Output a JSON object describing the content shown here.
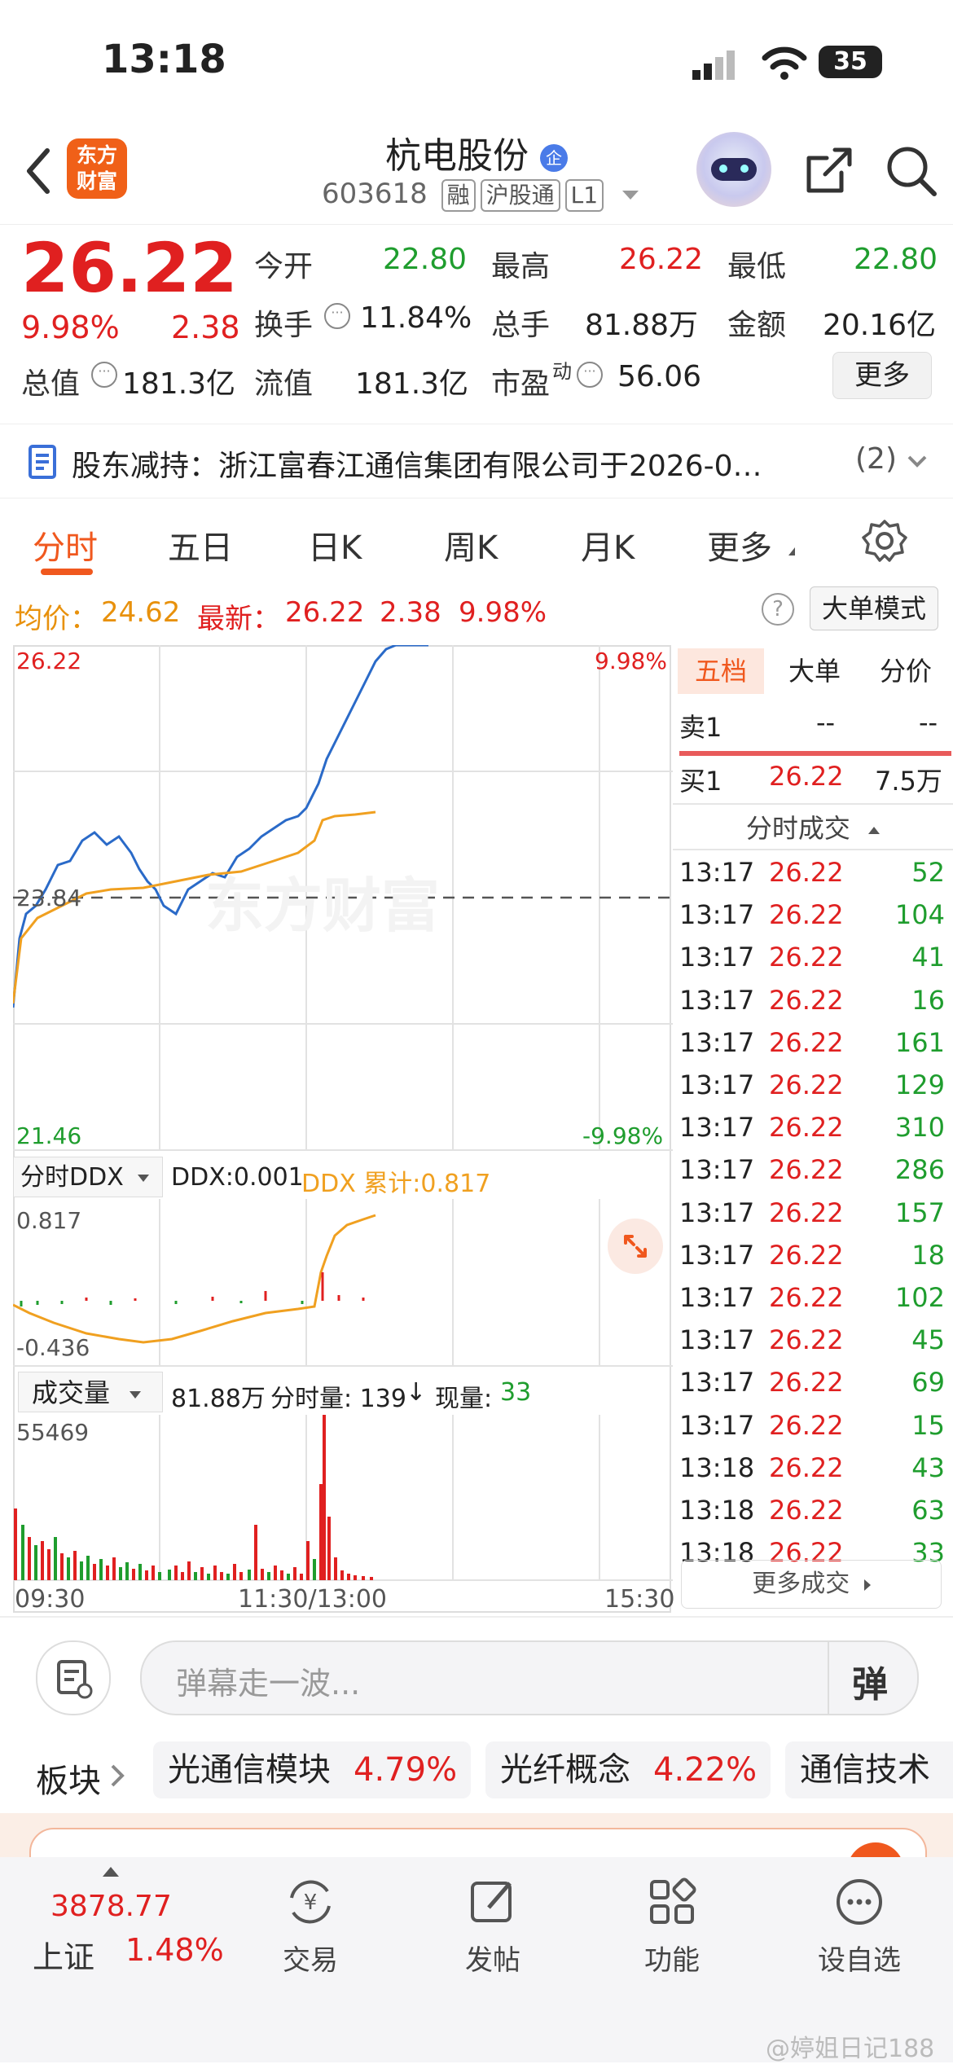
{
  "status": {
    "time": "13:18",
    "battery": "35"
  },
  "header": {
    "back_icon": "chevron-left-icon",
    "app_logo_text": "东方\n财富",
    "stock_name": "杭电股份",
    "badge": "企",
    "code": "603618",
    "tags": [
      "融",
      "沪股通",
      "L1"
    ]
  },
  "quote": {
    "price": "26.22",
    "change_pct": "9.98%",
    "change": "2.38",
    "fields": [
      {
        "label": "今开",
        "value": "22.80",
        "color": "#1f9d2e"
      },
      {
        "label": "最高",
        "value": "26.22",
        "color": "#e02020"
      },
      {
        "label": "最低",
        "value": "22.80",
        "color": "#1f9d2e"
      },
      {
        "label": "换手",
        "value": "11.84%",
        "color": "#222222"
      },
      {
        "label": "总手",
        "value": "81.88万",
        "color": "#222222"
      },
      {
        "label": "金额",
        "value": "20.16亿",
        "color": "#222222"
      },
      {
        "label": "总值",
        "value": "181.3亿",
        "color": "#222222"
      },
      {
        "label": "流值",
        "value": "181.3亿",
        "color": "#222222"
      },
      {
        "label": "市盈",
        "value": "56.06",
        "color": "#222222"
      }
    ],
    "pe_super": "动",
    "more_button": "更多"
  },
  "notice": {
    "text": "股东减持：浙江富春江通信集团有限公司于2026-0…",
    "count": "(2)"
  },
  "tabs": [
    "分时",
    "五日",
    "日K",
    "周K",
    "月K",
    "更多"
  ],
  "infobar": {
    "avg_label": "均价：",
    "avg_value": "24.62",
    "latest_label": "最新：",
    "latest_value": "26.22",
    "latest_change": "2.38",
    "latest_pct": "9.98%",
    "help_icon": "?",
    "big_order_mode": "大单模式"
  },
  "chart_labels": {
    "top_price": "26.22",
    "mid_price": "23.84",
    "bottom_price": "21.46",
    "top_pct": "9.98%",
    "bottom_pct": "-9.98%",
    "ddx_selector": "分时DDX",
    "ddx_value": "DDX:0.001",
    "ddx_cum": "DDX 累计:0.817",
    "ddx_top": "0.817",
    "ddx_bottom": "-0.436",
    "vol_selector": "成交量",
    "vol_total": "81.88万",
    "vol_minute": "分时量: 139",
    "vol_arrow": "↓",
    "vol_now_label": "现量:",
    "vol_now": "33",
    "vol_top": "55469",
    "t_start": "09:30",
    "t_mid": "11:30/13:00",
    "t_end": "15:30",
    "watermark": "东方财富"
  },
  "chart_data": {
    "type": "line",
    "x_range": [
      "09:30",
      "15:30"
    ],
    "ylim": [
      21.46,
      26.22
    ],
    "series": []
  },
  "sidebar": {
    "tabs": [
      "五档",
      "大单",
      "分价"
    ],
    "sell1": {
      "label": "卖1",
      "price": "--",
      "vol": "--"
    },
    "buy1": {
      "label": "买1",
      "price": "26.22",
      "vol": "7.5万"
    },
    "trades_title": "分时成交",
    "trades": [
      {
        "t": "13:17",
        "p": "26.22",
        "v": "52"
      },
      {
        "t": "13:17",
        "p": "26.22",
        "v": "104"
      },
      {
        "t": "13:17",
        "p": "26.22",
        "v": "41"
      },
      {
        "t": "13:17",
        "p": "26.22",
        "v": "16"
      },
      {
        "t": "13:17",
        "p": "26.22",
        "v": "161"
      },
      {
        "t": "13:17",
        "p": "26.22",
        "v": "129"
      },
      {
        "t": "13:17",
        "p": "26.22",
        "v": "310"
      },
      {
        "t": "13:17",
        "p": "26.22",
        "v": "286"
      },
      {
        "t": "13:17",
        "p": "26.22",
        "v": "157"
      },
      {
        "t": "13:17",
        "p": "26.22",
        "v": "18"
      },
      {
        "t": "13:17",
        "p": "26.22",
        "v": "102"
      },
      {
        "t": "13:17",
        "p": "26.22",
        "v": "45"
      },
      {
        "t": "13:17",
        "p": "26.22",
        "v": "69"
      },
      {
        "t": "13:17",
        "p": "26.22",
        "v": "15"
      },
      {
        "t": "13:18",
        "p": "26.22",
        "v": "43"
      },
      {
        "t": "13:18",
        "p": "26.22",
        "v": "63"
      },
      {
        "t": "13:18",
        "p": "26.22",
        "v": "33"
      }
    ],
    "more_trades": "更多成交"
  },
  "comment": {
    "placeholder": "弹幕走一波...",
    "danmu_button": "弹"
  },
  "sectors": {
    "label": "板块",
    "items": [
      {
        "name": "光通信模块",
        "pct": "4.79%"
      },
      {
        "name": "光纤概念",
        "pct": "4.22%"
      },
      {
        "name": "通信技术",
        "pct": ""
      }
    ]
  },
  "nav": {
    "index_value": "3878.77",
    "index_name": "上证",
    "index_pct": "1.48%",
    "items": [
      "交易",
      "发帖",
      "功能",
      "设自选"
    ]
  },
  "watermark_text": "@婷姐日记188"
}
